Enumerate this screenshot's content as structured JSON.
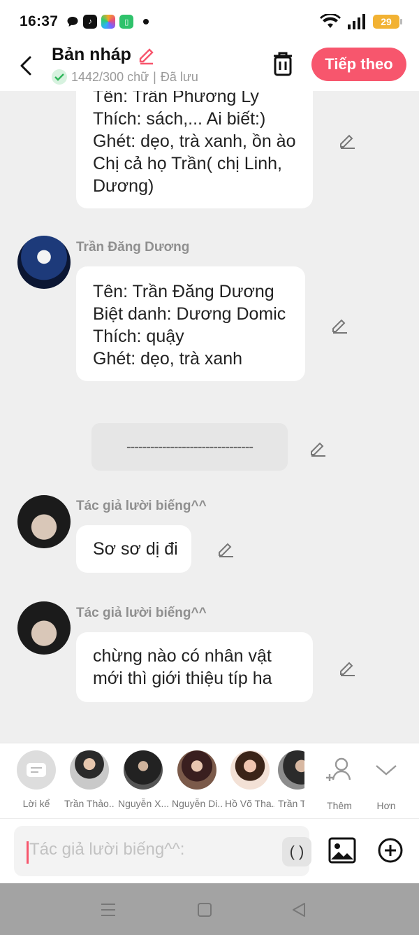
{
  "status_bar": {
    "time": "16:37",
    "battery": "29",
    "icons": [
      "chat-bubble-icon",
      "tiktok-icon",
      "photos-app-icon",
      "green-app-icon",
      "dot-icon",
      "wifi-icon",
      "signal-icon",
      "battery-icon"
    ]
  },
  "header": {
    "title": "Bản nháp",
    "word_count": "1442/300 chữ",
    "separator": "|",
    "saved": "Đã lưu",
    "next_label": "Tiếp theo"
  },
  "messages": [
    {
      "speaker": "",
      "lines": [
        "Tên: Trần Phương Ly",
        "Thích: sách,... Ai biết:)",
        "Ghét: dẹo, trà xanh, ồn ào",
        "Chị cả họ Trần( chị Linh,",
        "Dương)"
      ]
    },
    {
      "speaker": "Trần Đăng Dương",
      "lines": [
        "Tên: Trần Đăng Dương",
        "Biệt danh: Dương Domic",
        "Thích: quậy",
        "Ghét: dẹo, trà xanh"
      ]
    },
    {
      "speaker": "",
      "lines": [
        "--------------------------------"
      ],
      "narration": true
    },
    {
      "speaker": "Tác giả lười biếng^^",
      "lines": [
        "Sơ sơ dị đi"
      ]
    },
    {
      "speaker": "Tác giả lười biếng^^",
      "lines": [
        "chừng nào có nhân vật",
        "mới thì giới thiệu típ ha"
      ]
    }
  ],
  "character_bar": {
    "items": [
      {
        "label": "Lời kể"
      },
      {
        "label": "Trần Thảo..."
      },
      {
        "label": "Nguyễn X..."
      },
      {
        "label": "Nguyễn Di..."
      },
      {
        "label": "Hồ Võ Tha..."
      },
      {
        "label": "Trần T"
      }
    ],
    "add_label": "Thêm",
    "more_label": "Hơn"
  },
  "composer": {
    "placeholder": "Tác giả lười biếng^^:",
    "paren_label": "( )"
  },
  "colors": {
    "accent": "#f7566d",
    "background": "#efefef",
    "bubble": "#ffffff",
    "navbar": "#a3a3a3"
  }
}
